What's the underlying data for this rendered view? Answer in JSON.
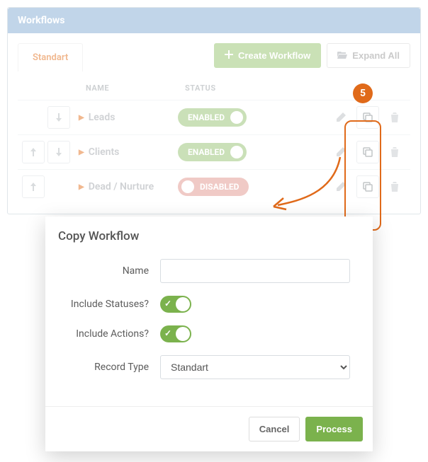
{
  "panel": {
    "title": "Workflows"
  },
  "tabs": {
    "active": "Standart"
  },
  "toolbar": {
    "create_label": "Create Workflow",
    "expand_label": "Expand All"
  },
  "columns": {
    "name": "NAME",
    "status": "STATUS"
  },
  "status_labels": {
    "enabled": "ENABLED",
    "disabled": "DISABLED"
  },
  "rows": [
    {
      "name": "Leads",
      "status": "enabled"
    },
    {
      "name": "Clients",
      "status": "enabled"
    },
    {
      "name": "Dead / Nurture",
      "status": "disabled"
    }
  ],
  "callout": {
    "step": "5"
  },
  "modal": {
    "title": "Copy Workflow",
    "labels": {
      "name": "Name",
      "include_statuses": "Include Statuses?",
      "include_actions": "Include Actions?",
      "record_type": "Record Type"
    },
    "values": {
      "name": "",
      "include_statuses": true,
      "include_actions": true,
      "record_type": "Standart"
    },
    "buttons": {
      "cancel": "Cancel",
      "process": "Process"
    }
  }
}
